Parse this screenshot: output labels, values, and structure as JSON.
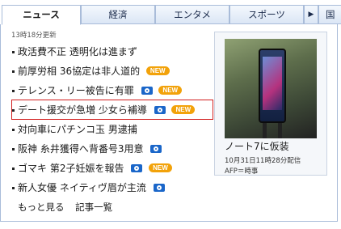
{
  "tabs": [
    {
      "label": "ニュース",
      "active": true
    },
    {
      "label": "経済",
      "active": false
    },
    {
      "label": "エンタメ",
      "active": false
    },
    {
      "label": "スポーツ",
      "active": false
    }
  ],
  "tab_more_icon": "triangle-right-icon",
  "tab_cut_label": "国",
  "updated": "13時18分更新",
  "news": [
    {
      "title": "政活費不正 透明化は進まず",
      "camera": false,
      "new": false
    },
    {
      "title": "前厚労相 36協定は非人道的",
      "camera": false,
      "new": true
    },
    {
      "title": "テレンス・リー被告に有罪",
      "camera": true,
      "new": true
    },
    {
      "title": "デート援交が急増 少女ら補導",
      "camera": true,
      "new": true
    },
    {
      "title": "対向車にパチンコ玉 男逮捕",
      "camera": false,
      "new": false
    },
    {
      "title": "阪神 糸井獲得へ背番号3用意",
      "camera": true,
      "new": false
    },
    {
      "title": "ゴマキ 第2子妊娠を報告",
      "camera": true,
      "new": true
    },
    {
      "title": "新人女優 ネイティヴ眉が主流",
      "camera": true,
      "new": false
    }
  ],
  "new_label": "NEW",
  "bottom": {
    "more": "もっと見る",
    "list": "記事一覧"
  },
  "photo": {
    "caption": "ノート7に仮装",
    "date": "10月31日11時28分配信",
    "source": "AFP＝時事"
  },
  "colors": {
    "highlight": "#d21e1e",
    "badge": "#f2a20a",
    "camera": "#1a66c9"
  }
}
